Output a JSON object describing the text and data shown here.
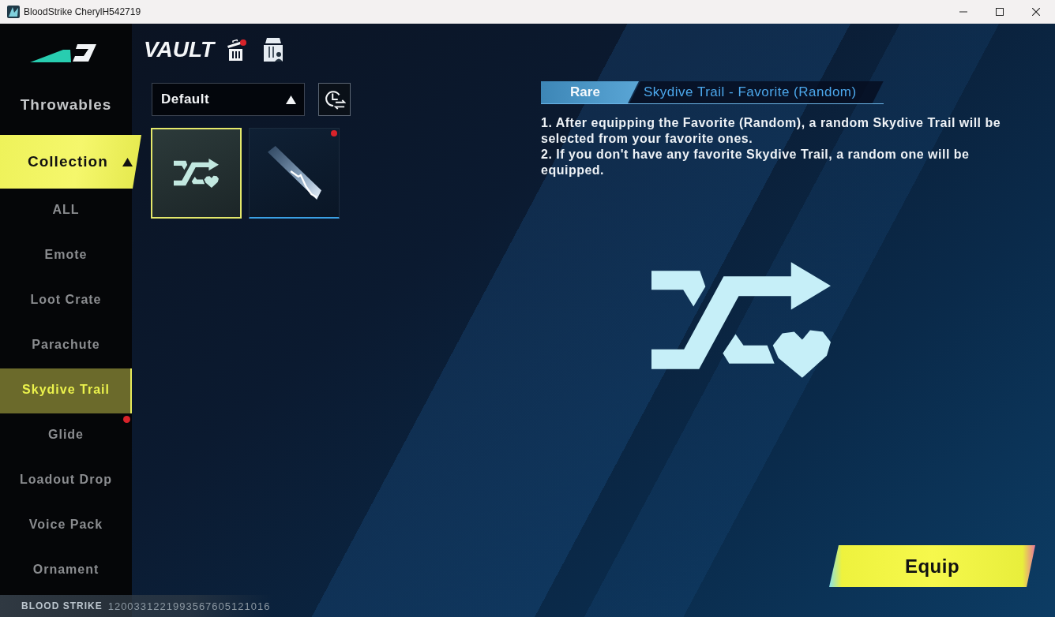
{
  "window": {
    "title": "BloodStrike CherylH542719"
  },
  "sidebar": {
    "categories": [
      {
        "label": "Throwables",
        "selected": false
      },
      {
        "label": "Collection",
        "selected": true,
        "expanded": true,
        "children": [
          {
            "label": "ALL",
            "selected": false,
            "badge": false
          },
          {
            "label": "Emote",
            "selected": false,
            "badge": false
          },
          {
            "label": "Loot Crate",
            "selected": false,
            "badge": false
          },
          {
            "label": "Parachute",
            "selected": false,
            "badge": false
          },
          {
            "label": "Skydive Trail",
            "selected": true,
            "badge": false
          },
          {
            "label": "Glide",
            "selected": false,
            "badge": true
          },
          {
            "label": "Loadout Drop",
            "selected": false,
            "badge": false
          },
          {
            "label": "Voice Pack",
            "selected": false,
            "badge": false
          },
          {
            "label": "Ornament",
            "selected": false,
            "badge": false
          }
        ]
      }
    ]
  },
  "footer": {
    "brand": "BLOOD STRIKE",
    "code": "1200331221993567605121016"
  },
  "vault": {
    "title": "VAULT",
    "trash_badge": true,
    "filter": {
      "value": "Default"
    },
    "items": [
      {
        "kind": "random",
        "selected": true,
        "badge": false
      },
      {
        "kind": "trail",
        "selected": false,
        "badge": true
      }
    ]
  },
  "detail": {
    "rarity": "Rare",
    "name": "Skydive Trail - Favorite (Random)",
    "notes": [
      "1. After equipping the Favorite (Random), a random Skydive Trail will be selected from your favorite ones.",
      "2. If you don't have any favorite Skydive Trail, a random one will be equipped."
    ],
    "preview": {
      "kind": "random"
    },
    "action": "Equip"
  }
}
